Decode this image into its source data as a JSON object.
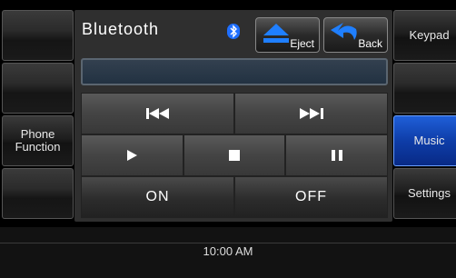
{
  "header": {
    "title": "Bluetooth",
    "bluetooth_icon": "bluetooth-icon"
  },
  "buttons": {
    "eject_label": "Eject",
    "back_label": "Back"
  },
  "left_menu": {
    "phone_function_line1": "Phone",
    "phone_function_line2": "Function"
  },
  "right_menu": {
    "keypad": "Keypad",
    "music": "Music",
    "settings": "Settings"
  },
  "controls": {
    "on_label": "ON",
    "off_label": "OFF"
  },
  "status_bar": {
    "time": "10:00 AM"
  },
  "colors": {
    "accent_blue": "#0e3da8",
    "bluetooth_blue": "#1f6fff"
  }
}
